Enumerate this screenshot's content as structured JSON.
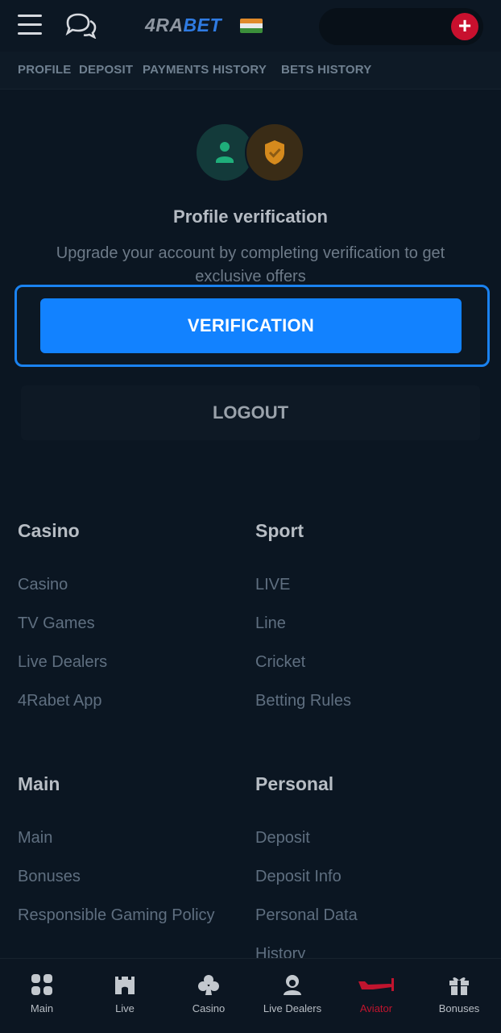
{
  "header": {
    "logo_part1": "4RA",
    "logo_part2": "BET",
    "plus_label": "+"
  },
  "tabs": [
    "PROFILE",
    "DEPOSIT",
    "PAYMENTS HISTORY",
    "BETS HISTORY"
  ],
  "verification": {
    "title": "Profile verification",
    "description": "Upgrade your account by completing verification to get exclusive offers",
    "button": "VERIFICATION",
    "logout": "LOGOUT"
  },
  "footer": {
    "casino": {
      "title": "Casino",
      "links": [
        "Casino",
        "TV Games",
        "Live Dealers",
        "4Rabet App"
      ]
    },
    "sport": {
      "title": "Sport",
      "links": [
        "LIVE",
        "Line",
        "Cricket",
        "Betting Rules"
      ]
    },
    "main": {
      "title": "Main",
      "links": [
        "Main",
        "Bonuses",
        "Responsible Gaming Policy"
      ]
    },
    "personal": {
      "title": "Personal",
      "links": [
        "Deposit",
        "Deposit Info",
        "Personal Data",
        "History"
      ]
    }
  },
  "bottom_nav": [
    {
      "label": "Main",
      "icon": "grid-icon"
    },
    {
      "label": "Live",
      "icon": "castle-icon"
    },
    {
      "label": "Casino",
      "icon": "club-icon"
    },
    {
      "label": "Live Dealers",
      "icon": "dealer-icon"
    },
    {
      "label": "Aviator",
      "icon": "plane-icon",
      "active": true
    },
    {
      "label": "Bonuses",
      "icon": "gift-icon"
    }
  ],
  "colors": {
    "background": "#0b1622",
    "accent_blue": "#1282ff",
    "accent_red": "#c8102e"
  }
}
